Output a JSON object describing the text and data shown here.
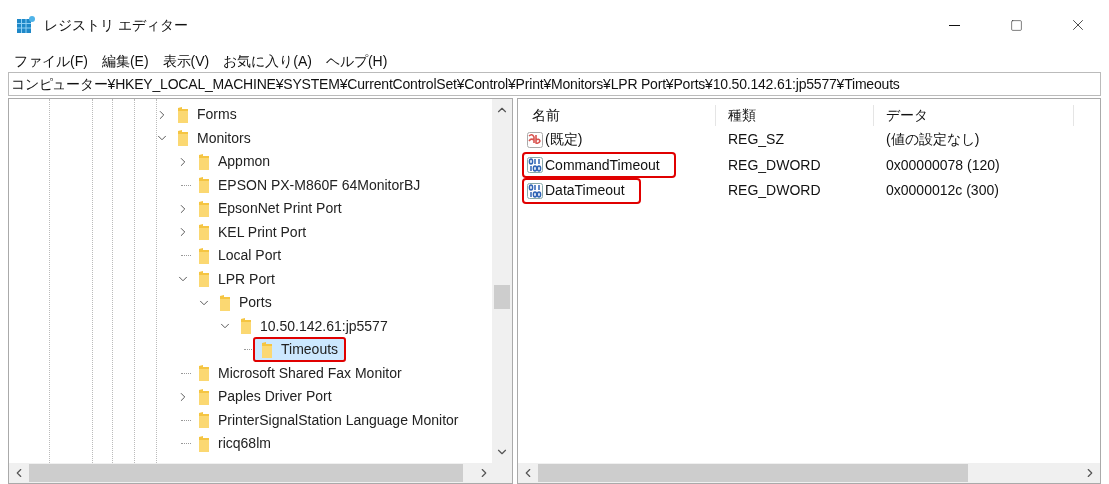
{
  "window": {
    "title": "レジストリ エディター"
  },
  "menu": [
    "ファイル(F)",
    "編集(E)",
    "表示(V)",
    "お気に入り(A)",
    "ヘルプ(H)"
  ],
  "address": "コンピューター¥HKEY_LOCAL_MACHINE¥SYSTEM¥CurrentControlSet¥Control¥Print¥Monitors¥LPR Port¥Ports¥10.50.142.61:jp5577¥Timeouts",
  "tree": [
    {
      "label": "Forms",
      "expanded": false,
      "selected": false,
      "highlighted": false
    },
    {
      "label": "Monitors",
      "expanded": true,
      "selected": false,
      "highlighted": false,
      "children": [
        {
          "label": "Appmon",
          "expanded": false,
          "selected": false,
          "highlighted": false
        },
        {
          "label": "EPSON PX-M860F 64MonitorBJ",
          "selected": false,
          "highlighted": false
        },
        {
          "label": "EpsonNet Print Port",
          "expanded": false,
          "selected": false,
          "highlighted": false
        },
        {
          "label": "KEL Print Port",
          "expanded": false,
          "selected": false,
          "highlighted": false
        },
        {
          "label": "Local Port",
          "selected": false,
          "highlighted": false
        },
        {
          "label": "LPR Port",
          "expanded": true,
          "selected": false,
          "highlighted": false,
          "children": [
            {
              "label": "Ports",
              "expanded": true,
              "selected": false,
              "highlighted": false,
              "children": [
                {
                  "label": "10.50.142.61:jp5577",
                  "expanded": true,
                  "selected": false,
                  "highlighted": false,
                  "children": [
                    {
                      "label": "Timeouts",
                      "selected": true,
                      "highlighted": true
                    }
                  ]
                }
              ]
            }
          ]
        },
        {
          "label": "Microsoft Shared Fax Monitor",
          "selected": false,
          "highlighted": false
        },
        {
          "label": "Paples Driver Port",
          "expanded": false,
          "selected": false,
          "highlighted": false
        },
        {
          "label": "PrinterSignalStation Language Monitor",
          "selected": false,
          "highlighted": false
        },
        {
          "label": "ricq68lm",
          "selected": false,
          "highlighted": false
        }
      ]
    }
  ],
  "values": {
    "columns": [
      "名前",
      "種類",
      "データ"
    ],
    "rows": [
      {
        "kind": "string",
        "name": "(既定)",
        "type": "REG_SZ",
        "data": "(値の設定なし)",
        "highlighted": false
      },
      {
        "kind": "binary",
        "name": "CommandTimeout",
        "type": "REG_DWORD",
        "data": "0x00000078 (120)",
        "highlighted": true
      },
      {
        "kind": "binary",
        "name": "DataTimeout",
        "type": "REG_DWORD",
        "data": "0x0000012c (300)",
        "highlighted": true
      }
    ]
  }
}
